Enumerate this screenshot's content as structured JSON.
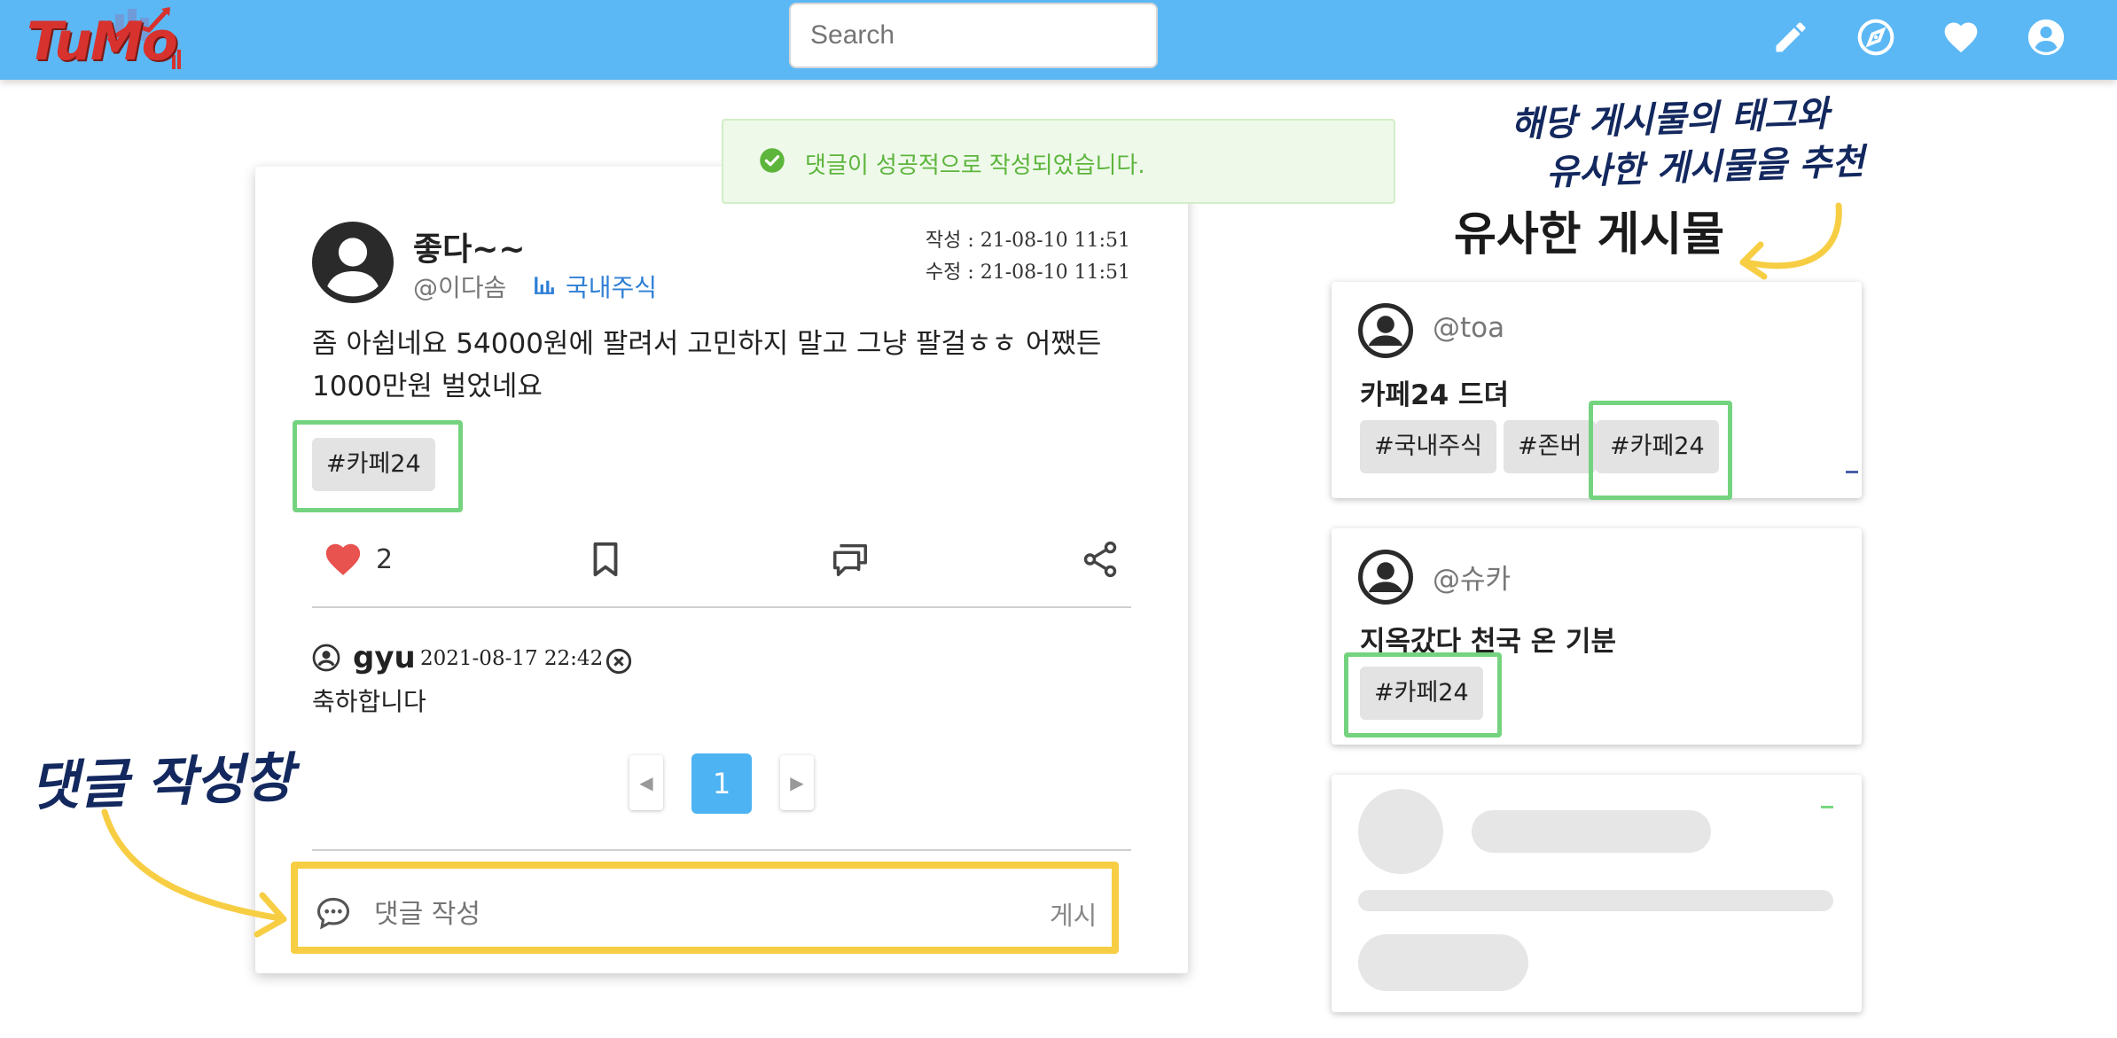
{
  "header": {
    "logo_text": "TuMo",
    "search_placeholder": "Search",
    "icons": [
      "edit-pencil-icon",
      "compass-icon",
      "heart-icon",
      "account-circle-icon"
    ],
    "background_color": "#5bb8f5"
  },
  "alert": {
    "message": "댓글이 성공적으로 작성되었습니다.",
    "icon": "check-circle-icon",
    "color": "#5db53c"
  },
  "post": {
    "title": "좋다~~",
    "author": "@이다솜",
    "category": "국내주식",
    "created_label": "작성 : 21-08-10 11:51",
    "updated_label": "수정 : 21-08-10 11:51",
    "body": "좀 아쉽네요 54000원에 팔려서 고민하지 말고 그냥 팔걸ㅎㅎ 어쨌든 1000만원 벌었네요",
    "tags": [
      "#카페24"
    ],
    "like_count": "2",
    "accent_like_color": "#e8524f"
  },
  "comments": [
    {
      "user": "gyu",
      "date": "2021-08-17 22:42",
      "text": "축하합니다"
    }
  ],
  "pagination": {
    "current_page": "1"
  },
  "comment_form": {
    "placeholder": "댓글 작성",
    "submit_label": "게시"
  },
  "similar": {
    "title": "유사한 게시물",
    "items": [
      {
        "user": "@toa",
        "title": "카페24 드뎌",
        "tags": [
          "#국내주식",
          "#존버",
          "#카페24"
        ]
      },
      {
        "user": "@슈카",
        "title": "지옥갔다 천국 온 기분",
        "tags": [
          "#카페24"
        ]
      }
    ]
  },
  "annotations": {
    "recommend_line1": "해당 게시물의 태그와",
    "recommend_line2": "유사한 게시물을 추천",
    "comment_box_note": "댓글 작성창",
    "highlight_yellow": "#f7ce43",
    "highlight_green": "#74d37f"
  }
}
